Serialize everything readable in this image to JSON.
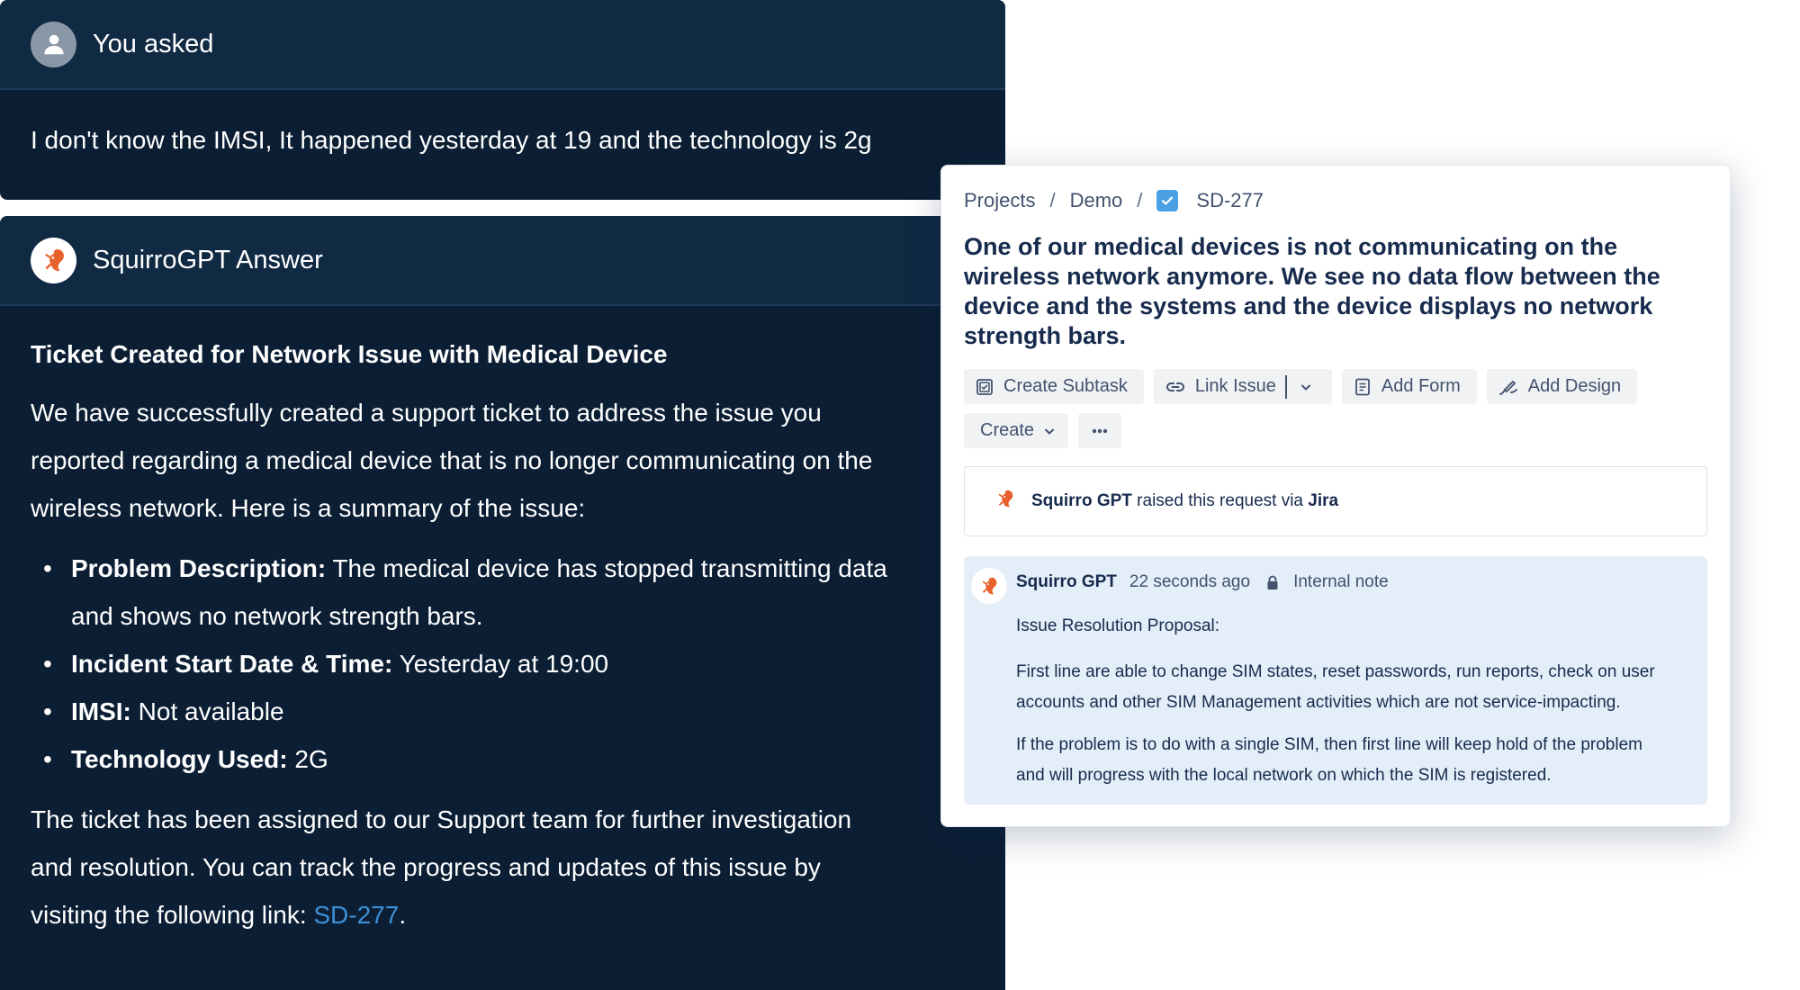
{
  "question": {
    "header": "You asked",
    "text": "I don't know the IMSI, It happened yesterday at 19 and the technology is 2g"
  },
  "answer": {
    "header": "SquirroGPT Answer",
    "heading": "Ticket Created for Network Issue with Medical Device",
    "intro_lines": [
      "We have successfully created a support ticket to address the issue you",
      "reported regarding a medical device that is no longer communicating on the",
      "wireless network. Here is a summary of the issue:"
    ],
    "items": [
      {
        "label": "Problem Description:",
        "lines": [
          "The medical device has stopped transmitting data",
          "and shows no network strength bars."
        ]
      },
      {
        "label": "Incident Start Date & Time:",
        "lines": [
          "Yesterday at 19:00"
        ]
      },
      {
        "label": "IMSI:",
        "lines": [
          "Not available"
        ]
      },
      {
        "label": "Technology Used:",
        "lines": [
          "2G"
        ]
      }
    ],
    "closing_lines": [
      "The ticket has been assigned to our Support team for further investigation",
      "and resolution. You can track the progress and updates of this issue by"
    ],
    "closing_last_prefix": "visiting the following link: ",
    "link_text": "SD-277",
    "closing_last_suffix": "."
  },
  "jira": {
    "breadcrumb": {
      "projects": "Projects",
      "separator": "/",
      "demo": "Demo",
      "issue_key": "SD-277"
    },
    "title": "One of our medical devices is not communicating on the wireless network anymore. We see no data flow between the device and the systems and the device displays no network strength bars.",
    "toolbar": {
      "create_subtask": "Create Subtask",
      "link_issue": "Link Issue",
      "add_form": "Add Form",
      "add_design": "Add Design",
      "create": "Create"
    },
    "request": {
      "author": "Squirro GPT",
      "middle": " raised this request via ",
      "channel": "Jira"
    },
    "note": {
      "author": "Squirro GPT",
      "time": "22 seconds ago",
      "type": "Internal note",
      "heading": "Issue Resolution Proposal:",
      "para1_lines": [
        "First line are able to change SIM states, reset passwords, run reports, check on user",
        "accounts and other SIM Management activities which are not service-impacting."
      ],
      "para2_lines": [
        "If the problem is to do with a single SIM, then first line will keep hold of the problem",
        "and will progress with the local network on which the SIM is registered."
      ]
    }
  },
  "colors": {
    "chat_background": "#0b1e34",
    "chat_header": "#112a44",
    "link": "#3d8fd6",
    "note_background": "#e3eef9",
    "squirrel_orange": "#e8612c",
    "checkbox_blue": "#4b9fe3"
  },
  "icons": {
    "user_avatar": "person-icon",
    "bot_avatar": "squirrel-logo-icon",
    "issue_type": "checkbox-icon",
    "subtask": "subtask-icon",
    "link": "link-icon",
    "form": "form-icon",
    "design": "design-icon",
    "chevron": "chevron-down-icon",
    "more": "more-dots-icon",
    "lock": "lock-icon"
  }
}
